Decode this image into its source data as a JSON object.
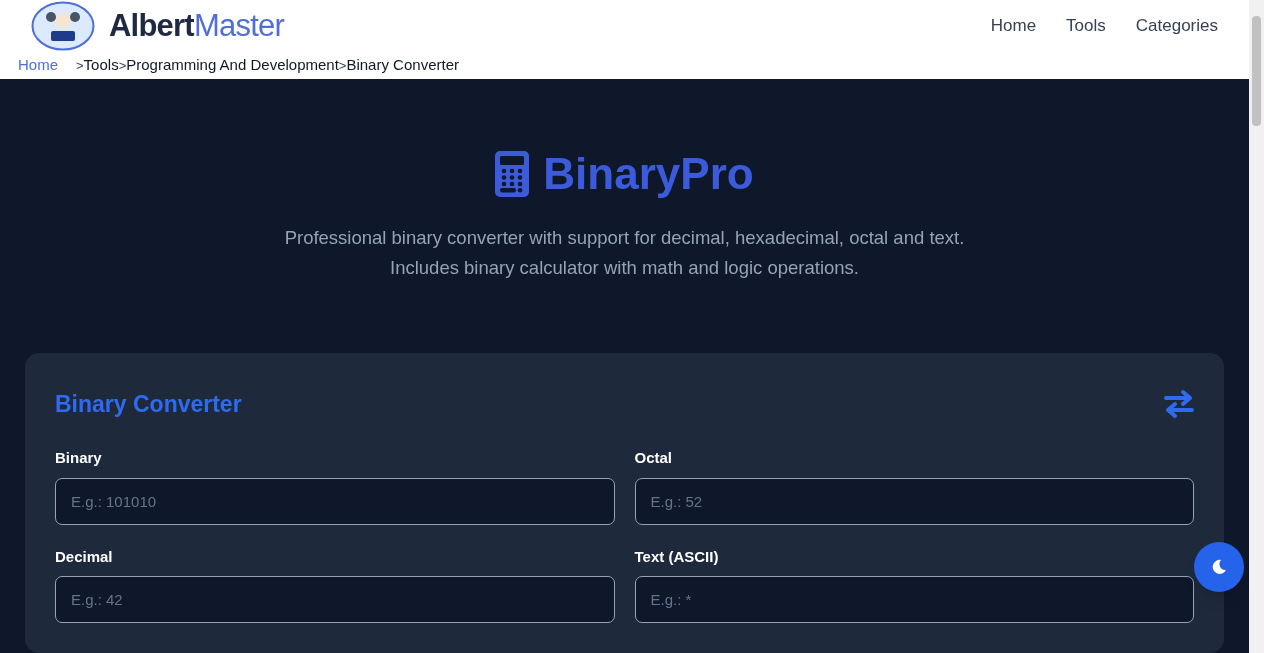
{
  "header": {
    "brand": {
      "part1": "Albert",
      "part2": "Master"
    },
    "nav": [
      "Home",
      "Tools",
      "Categories"
    ]
  },
  "breadcrumb": [
    {
      "kind": "link",
      "text": "Home"
    },
    {
      "kind": "sep",
      "text": ">"
    },
    {
      "kind": "crumb",
      "text": "Tools"
    },
    {
      "kind": "sep",
      "text": ">"
    },
    {
      "kind": "crumb",
      "text": "Programming And Development"
    },
    {
      "kind": "sep",
      "text": ">"
    },
    {
      "kind": "crumb",
      "text": "Binary Converter"
    }
  ],
  "hero": {
    "title": "BinaryPro",
    "description": "Professional binary converter with support for decimal, hexadecimal, octal and text. Includes binary calculator with math and logic operations."
  },
  "converter": {
    "title": "Binary Converter",
    "fields": [
      {
        "label": "Binary",
        "placeholder": "E.g.: 101010"
      },
      {
        "label": "Octal",
        "placeholder": "E.g.: 52"
      },
      {
        "label": "Decimal",
        "placeholder": "E.g.: 42"
      },
      {
        "label": "Text (ASCII)",
        "placeholder": "E.g.: *"
      }
    ]
  }
}
